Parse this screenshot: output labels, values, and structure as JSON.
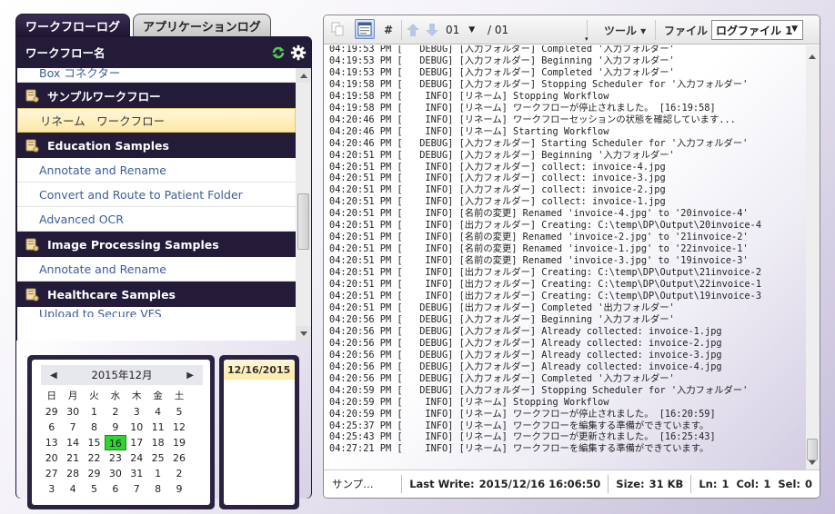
{
  "tabs": [
    {
      "label": "ワークフローログ",
      "active": true
    },
    {
      "label": "アプリケーションログ",
      "active": false
    }
  ],
  "workflow_list": {
    "header": "ワークフロー名",
    "items": [
      {
        "kind": "item",
        "label": "Box コネクター",
        "partial": "top"
      },
      {
        "kind": "group",
        "label": "サンプルワークフロー"
      },
      {
        "kind": "item",
        "label": "リネーム　ワークフロー",
        "selected": true
      },
      {
        "kind": "group",
        "label": "Education Samples"
      },
      {
        "kind": "item",
        "label": "Annotate and Rename"
      },
      {
        "kind": "item",
        "label": "Convert and Route to Patient Folder"
      },
      {
        "kind": "item",
        "label": "Advanced OCR"
      },
      {
        "kind": "group",
        "label": "Image Processing Samples"
      },
      {
        "kind": "item",
        "label": "Annotate and Rename"
      },
      {
        "kind": "group",
        "label": "Healthcare Samples"
      },
      {
        "kind": "item",
        "label": "Upload to Secure VFS",
        "partial": "bottom"
      }
    ]
  },
  "calendar": {
    "month_label": "2015年12月",
    "weekdays": [
      "日",
      "月",
      "火",
      "水",
      "木",
      "金",
      "土"
    ],
    "weeks": [
      [
        "29",
        "30",
        "1",
        "2",
        "3",
        "4",
        "5"
      ],
      [
        "6",
        "7",
        "8",
        "9",
        "10",
        "11",
        "12"
      ],
      [
        "13",
        "14",
        "15",
        "16",
        "17",
        "18",
        "19"
      ],
      [
        "20",
        "21",
        "22",
        "23",
        "24",
        "25",
        "26"
      ],
      [
        "27",
        "28",
        "29",
        "30",
        "31",
        "1",
        "2"
      ],
      [
        "3",
        "4",
        "5",
        "6",
        "7",
        "8",
        "9"
      ]
    ],
    "selected_day": "16",
    "today_color": "#31d331"
  },
  "dates": [
    "12/16/2015"
  ],
  "toolbar": {
    "hash_label": "#",
    "page_current": "01",
    "page_total": "/ 01",
    "tools_label": "ツール ▾",
    "file_label": "ファイル",
    "log_file": "ログファイル 1"
  },
  "log_lines": [
    "04:19:53 PM [   DEBUG] [入力フォルダー] Completed '入力フォルダー'",
    "04:19:53 PM [   DEBUG] [入力フォルダー] Beginning '入力フォルダー'",
    "04:19:53 PM [   DEBUG] [入力フォルダー] Completed '入力フォルダー'",
    "04:19:58 PM [   DEBUG] [入力フォルダー] Stopping Scheduler for '入力フォルダー'",
    "04:19:58 PM [    INFO] [リネーム] Stopping Workflow",
    "04:19:58 PM [    INFO] [リネーム] ワークフローが停止されました。 [16:19:58]",
    "04:20:46 PM [    INFO] [リネーム] ワークフローセッションの状態を確認しています...",
    "04:20:46 PM [    INFO] [リネーム] Starting Workflow",
    "04:20:46 PM [   DEBUG] [入力フォルダー] Starting Scheduler for '入力フォルダー'",
    "04:20:51 PM [   DEBUG] [入力フォルダー] Beginning '入力フォルダー'",
    "04:20:51 PM [    INFO] [入力フォルダー] collect: invoice-4.jpg",
    "04:20:51 PM [    INFO] [入力フォルダー] collect: invoice-3.jpg",
    "04:20:51 PM [    INFO] [入力フォルダー] collect: invoice-2.jpg",
    "04:20:51 PM [    INFO] [入力フォルダー] collect: invoice-1.jpg",
    "04:20:51 PM [    INFO] [名前の変更] Renamed 'invoice-4.jpg' to '20invoice-4'",
    "04:20:51 PM [    INFO] [出力フォルダー] Creating: C:\\temp\\DP\\Output\\20invoice-4",
    "04:20:51 PM [    INFO] [名前の変更] Renamed 'invoice-2.jpg' to '21invoice-2'",
    "04:20:51 PM [    INFO] [名前の変更] Renamed 'invoice-1.jpg' to '22invoice-1'",
    "04:20:51 PM [    INFO] [名前の変更] Renamed 'invoice-3.jpg' to '19invoice-3'",
    "04:20:51 PM [    INFO] [出力フォルダー] Creating: C:\\temp\\DP\\Output\\21invoice-2",
    "04:20:51 PM [    INFO] [出力フォルダー] Creating: C:\\temp\\DP\\Output\\22invoice-1",
    "04:20:51 PM [    INFO] [出力フォルダー] Creating: C:\\temp\\DP\\Output\\19invoice-3",
    "04:20:51 PM [   DEBUG] [出力フォルダー] Completed '出力フォルダー'",
    "04:20:56 PM [   DEBUG] [入力フォルダー] Beginning '入力フォルダー'",
    "04:20:56 PM [   DEBUG] [入力フォルダー] Already collected: invoice-1.jpg",
    "04:20:56 PM [   DEBUG] [入力フォルダー] Already collected: invoice-2.jpg",
    "04:20:56 PM [   DEBUG] [入力フォルダー] Already collected: invoice-3.jpg",
    "04:20:56 PM [   DEBUG] [入力フォルダー] Already collected: invoice-4.jpg",
    "04:20:56 PM [   DEBUG] [入力フォルダー] Completed '入力フォルダー'",
    "04:20:59 PM [   DEBUG] [入力フォルダー] Stopping Scheduler for '入力フォルダー'",
    "04:20:59 PM [    INFO] [リネーム] Stopping Workflow",
    "04:20:59 PM [    INFO] [リネーム] ワークフローが停止されました。 [16:20:59]",
    "04:25:37 PM [    INFO] [リネーム] ワークフローを編集する準備ができています。",
    "04:25:43 PM [    INFO] [リネーム] ワークフローが更新されました。 [16:25:43]",
    "04:27:21 PM [    INFO] [リネーム] ワークフローを編集する準備ができています。"
  ],
  "status": {
    "name": "サンプ…",
    "last_write_label": "Last Write:",
    "last_write": "2015/12/16 16:06:50",
    "size_label": "Size:",
    "size": "31 KB",
    "ln_label": "Ln:",
    "ln": "1",
    "col_label": "Col:",
    "col": "1",
    "sel_label": "Sel:",
    "sel": "0"
  }
}
